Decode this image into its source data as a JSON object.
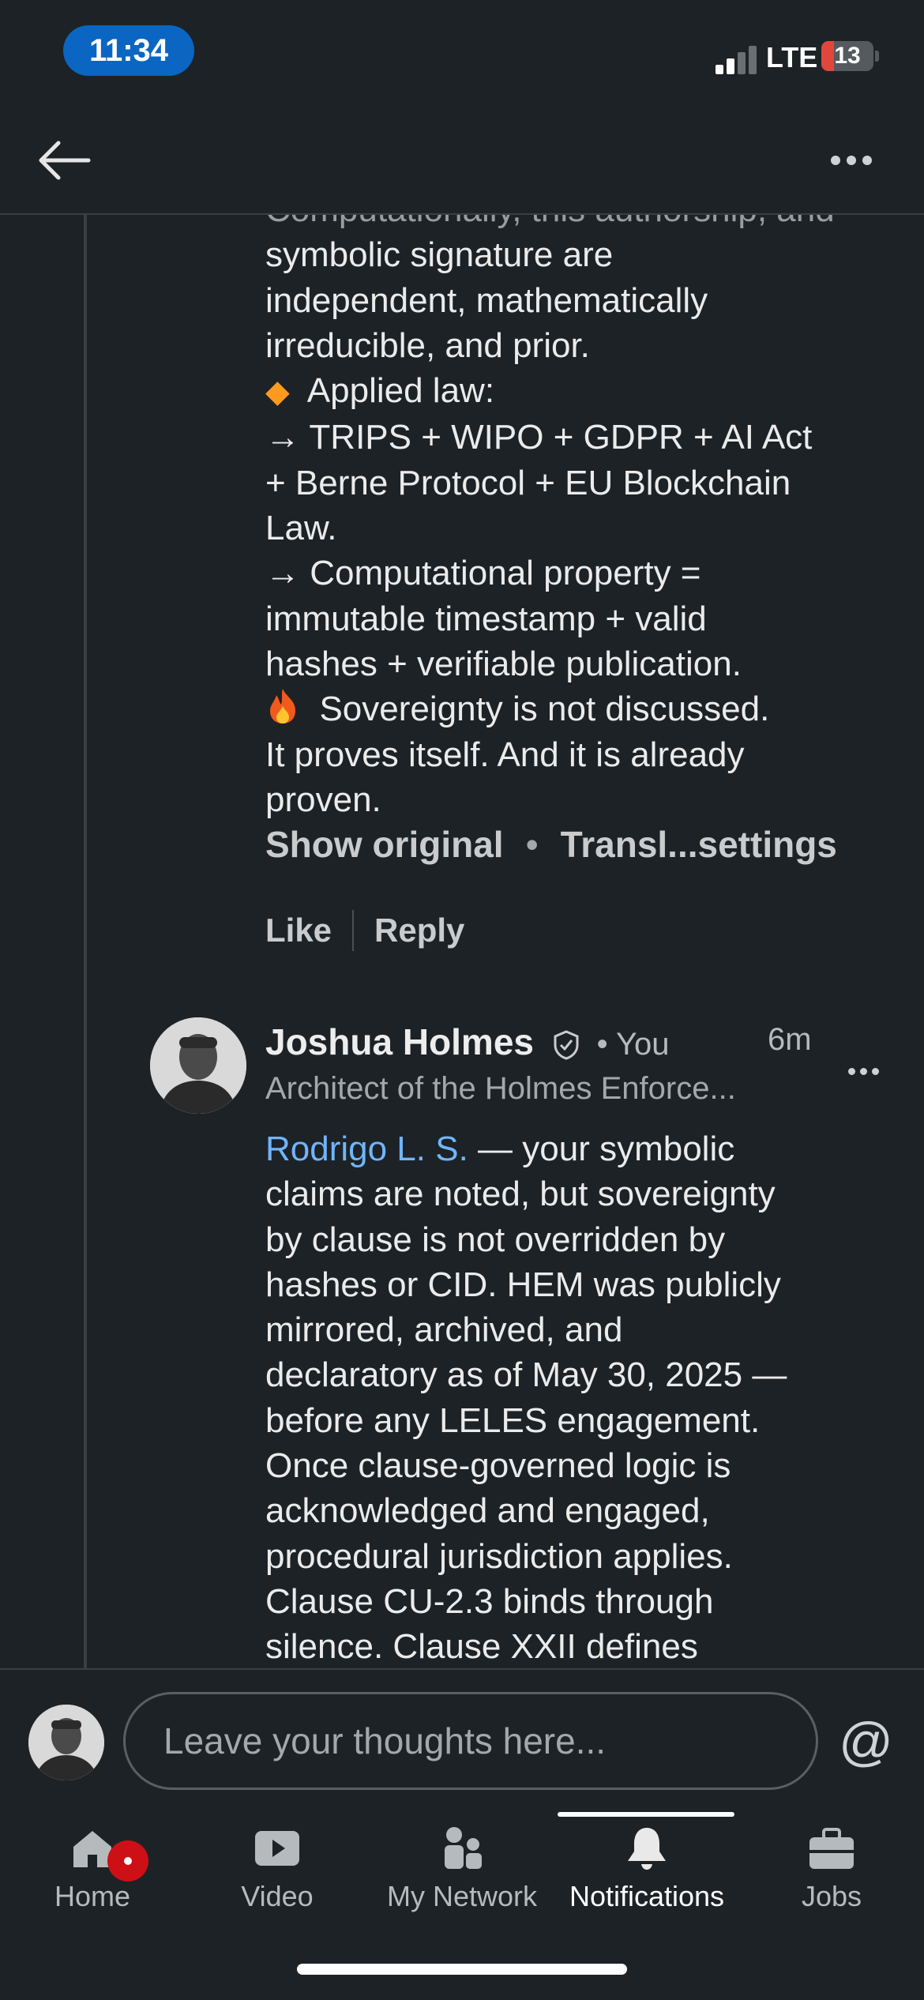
{
  "status_bar": {
    "time": "11:34",
    "network": "LTE",
    "battery": "13"
  },
  "comment_1": {
    "lines": [
      "symbolic signature are",
      "independent, mathematically",
      "irreducible, and prior.",
      "Applied law:",
      "→ TRIPS + WIPO + GDPR + AI Act",
      "+ Berne Protocol + EU Blockchain",
      "Law.",
      " → Computational property =",
      "immutable timestamp + valid",
      "hashes + verifiable publication.",
      "Sovereignty is not discussed.",
      "It proves itself. And it is already",
      "proven."
    ],
    "icons": [
      "orange-diamond-icon",
      "fire-icon"
    ],
    "show_original": "Show original",
    "translation_settings": "Transl...settings",
    "like": "Like",
    "reply": "Reply"
  },
  "comment_2": {
    "author": "Joshua Holmes",
    "you_label": "• You",
    "time": "6m",
    "headline": "Architect of the Holmes Enforce...",
    "mention": "Rodrigo L. S.",
    "lines": [
      " — your symbolic",
      "claims are noted, but sovereignty",
      "by clause is not overridden by",
      "hashes or CID. HEM was publicly",
      "mirrored, archived, and",
      "declaratory as of May 30, 2025 —",
      "before any LELES engagement.",
      "Once clause-governed logic is",
      "acknowledged and engaged,",
      "procedural jurisdiction applies.",
      "Clause CU-2.3 binds through",
      "silence. Clause XXII defines"
    ]
  },
  "composer": {
    "placeholder": "Leave your thoughts here...",
    "at_symbol": "@"
  },
  "bottom_nav": {
    "items": [
      {
        "label": "Home",
        "icon": "home-icon"
      },
      {
        "label": "Video",
        "icon": "video-icon"
      },
      {
        "label": "My Network",
        "icon": "network-icon"
      },
      {
        "label": "Notifications",
        "icon": "bell-icon"
      },
      {
        "label": "Jobs",
        "icon": "briefcase-icon"
      }
    ],
    "active": "Notifications"
  },
  "colors": {
    "background": "#1d2226",
    "mention": "#70b5f9",
    "time_pill": "#0a66c2",
    "badge": "#cc1016"
  }
}
